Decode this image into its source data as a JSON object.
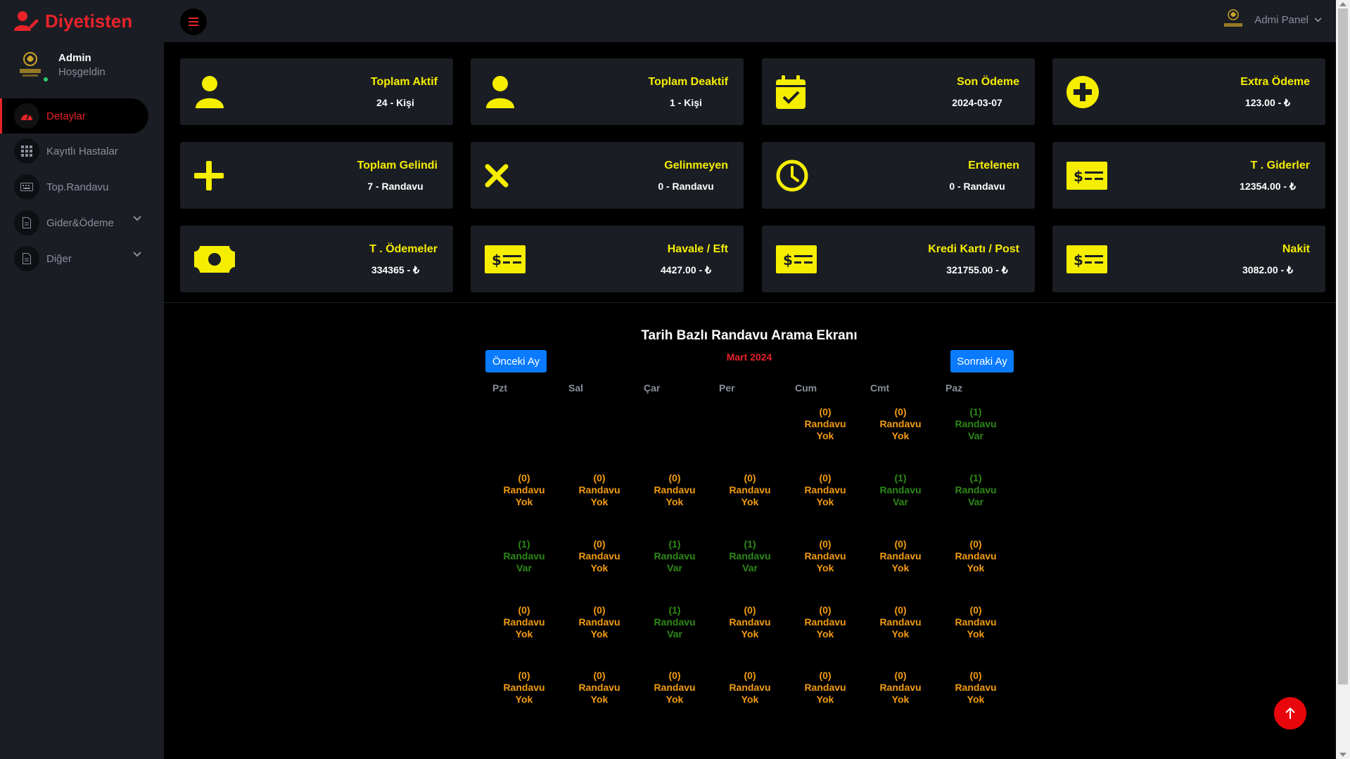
{
  "brand": {
    "name": "Diyetisten"
  },
  "user": {
    "name": "Admin",
    "greeting": "Hoşgeldin"
  },
  "sidebar": {
    "items": [
      {
        "label": "Detaylar",
        "icon": "gauge-icon",
        "active": true
      },
      {
        "label": "Kayıtlı Hastalar",
        "icon": "grid-icon"
      },
      {
        "label": "Top.Randavu",
        "icon": "keyboard-icon"
      },
      {
        "label": "Gider&Ödeme",
        "icon": "file-icon",
        "has_submenu": true
      },
      {
        "label": "Diğer",
        "icon": "file-icon",
        "has_submenu": true
      }
    ]
  },
  "topbar": {
    "panel_label": "Admi Panel"
  },
  "cards": [
    {
      "title": "Toplam Aktif",
      "value": "24 - Kişi",
      "icon": "user-icon"
    },
    {
      "title": "Toplam Deaktif",
      "value": "1 - Kişi",
      "icon": "user-icon"
    },
    {
      "title": "Son Ödeme",
      "value": "2024-03-07",
      "icon": "calendar-check-icon"
    },
    {
      "title": "Extra Ödeme",
      "value": "123.00 - ₺",
      "icon": "plus-circle-icon"
    },
    {
      "title": "Toplam Gelindi",
      "value": "7 - Randavu",
      "icon": "plus-icon"
    },
    {
      "title": "Gelinmeyen",
      "value": "0 - Randavu",
      "icon": "x-icon"
    },
    {
      "title": "Ertelenen",
      "value": "0 - Randavu",
      "icon": "clock-icon"
    },
    {
      "title": "T . Giderler",
      "value": "12354.00 - ₺",
      "icon": "money-check-icon"
    },
    {
      "title": "T . Ödemeler",
      "value": "334365 - ₺",
      "icon": "money-bill-icon"
    },
    {
      "title": "Havale / Eft",
      "value": "4427.00 - ₺",
      "icon": "money-check-icon"
    },
    {
      "title": "Kredi Kartı / Post",
      "value": "321755.00 - ₺",
      "icon": "money-check-icon"
    },
    {
      "title": "Nakit",
      "value": "3082.00 - ₺",
      "icon": "money-check-icon"
    }
  ],
  "calendar": {
    "title": "Tarih Bazlı Randavu Arama Ekranı",
    "prev_label": "Önceki Ay",
    "next_label": "Sonraki Ay",
    "month": "Mart 2024",
    "weekdays": [
      "Pzt",
      "Sal",
      "Çar",
      "Per",
      "Cum",
      "Cmt",
      "Paz"
    ],
    "leading_blanks": 4,
    "days": [
      0,
      0,
      1,
      0,
      0,
      0,
      0,
      0,
      1,
      1,
      1,
      0,
      1,
      1,
      0,
      0,
      0,
      0,
      0,
      1,
      0,
      0,
      0,
      0,
      0,
      0,
      0,
      0,
      0,
      0,
      0
    ],
    "label_none": "Randavu Yok",
    "label_some": "Randavu Var",
    "color_none": "#f39c12",
    "color_some": "#2d8a17"
  },
  "colors": {
    "accent": "#e8232a",
    "card_title": "#f5ee00",
    "card_bg": "#1b1d24",
    "button": "#0a7bff"
  }
}
